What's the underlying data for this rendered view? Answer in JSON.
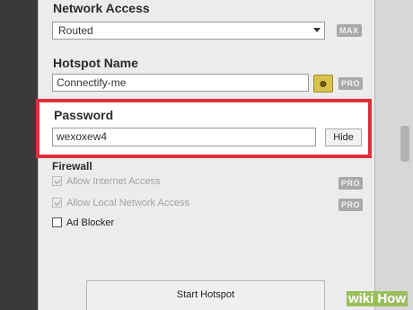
{
  "network_access": {
    "label": "Network Access",
    "selected": "Routed",
    "badge": "MAX"
  },
  "hotspot_name": {
    "label": "Hotspot Name",
    "value": "Connectify-me",
    "emoji_icon": "smiley-icon",
    "badge": "PRO"
  },
  "password": {
    "label": "Password",
    "value": "wexoxew4",
    "hide_button": "Hide",
    "highlight_color": "#e02f3a"
  },
  "firewall": {
    "label": "Firewall",
    "options": [
      {
        "label": "Allow Internet Access",
        "checked": true,
        "enabled": false,
        "badge": "PRO"
      },
      {
        "label": "Allow Local Network Access",
        "checked": true,
        "enabled": false,
        "badge": "PRO"
      },
      {
        "label": "Ad Blocker",
        "checked": false,
        "enabled": true
      }
    ]
  },
  "start_button": "Start Hotspot",
  "watermark": {
    "part1": "wiki",
    "part2": "How"
  }
}
